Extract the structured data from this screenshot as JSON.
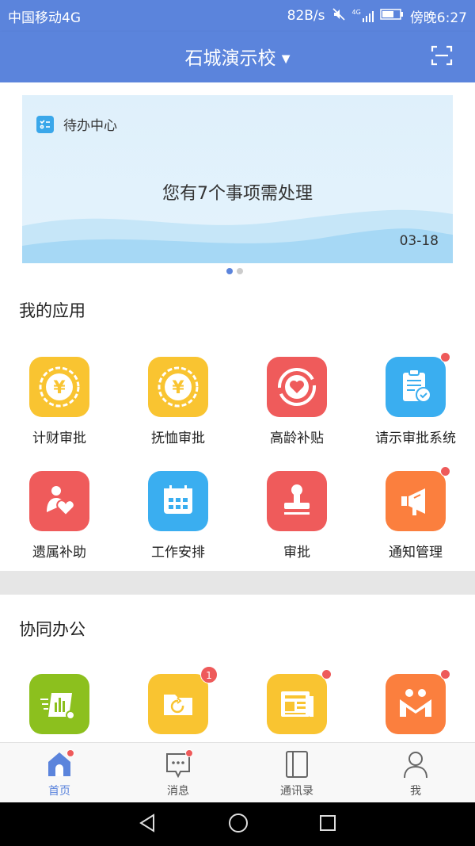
{
  "status_bar": {
    "carrier": "中国移动4G",
    "speed": "82B/s",
    "signal": "4G",
    "time": "傍晚6:27"
  },
  "header": {
    "title": "石城演示校",
    "dropdown_icon": "caret-down-icon",
    "scan_icon": "scan-icon"
  },
  "banner": {
    "label": "待办中心",
    "message": "您有7个事项需处理",
    "date": "03-18",
    "page_count": 2,
    "active_page": 1
  },
  "my_apps": {
    "title": "我的应用",
    "items": [
      {
        "label": "计财审批",
        "icon": "yuan-coin-icon",
        "color": "#f9c431",
        "dot": false
      },
      {
        "label": "抚恤审批",
        "icon": "yuan-coin-icon",
        "color": "#f9c431",
        "dot": false
      },
      {
        "label": "高龄补贴",
        "icon": "heart-circle-icon",
        "color": "#ef5b5b",
        "dot": false
      },
      {
        "label": "请示审批系统",
        "icon": "clipboard-check-icon",
        "color": "#3aaef0",
        "dot": true
      },
      {
        "label": "遗属补助",
        "icon": "person-heart-icon",
        "color": "#ef5b5b",
        "dot": false
      },
      {
        "label": "工作安排",
        "icon": "calendar-icon",
        "color": "#3aaef0",
        "dot": false
      },
      {
        "label": "审批",
        "icon": "stamp-icon",
        "color": "#ef5b5b",
        "dot": false
      },
      {
        "label": "通知管理",
        "icon": "megaphone-icon",
        "color": "#fb7f3e",
        "dot": true
      }
    ]
  },
  "collab": {
    "title": "协同办公",
    "items": [
      {
        "icon": "chart-gear-icon",
        "color": "#8cc01e",
        "badge": ""
      },
      {
        "icon": "folder-refresh-icon",
        "color": "#f9c431",
        "badge": "1"
      },
      {
        "icon": "newspaper-icon",
        "color": "#f9c431",
        "badge": ""
      },
      {
        "icon": "m-logo-icon",
        "color": "#fb7f3e",
        "badge": ""
      }
    ]
  },
  "tabbar": [
    {
      "label": "首页",
      "icon": "home-icon",
      "active": true,
      "dot": true
    },
    {
      "label": "消息",
      "icon": "message-icon",
      "active": false,
      "dot": true
    },
    {
      "label": "通讯录",
      "icon": "contacts-icon",
      "active": false,
      "dot": false
    },
    {
      "label": "我",
      "icon": "person-icon",
      "active": false,
      "dot": false
    }
  ],
  "colors": {
    "primary": "#5b84dc",
    "badge": "#ee5a5a"
  }
}
